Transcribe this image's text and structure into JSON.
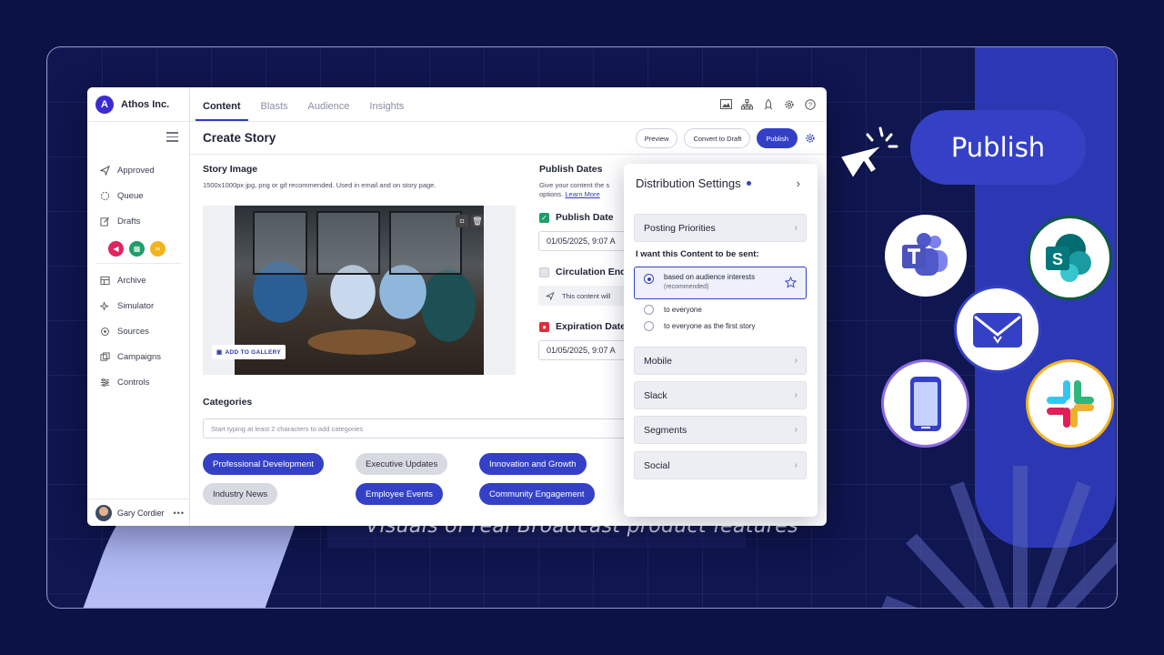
{
  "brand": {
    "name": "Athos Inc.",
    "logo_letter": "A"
  },
  "tabs": [
    {
      "label": "Content",
      "active": true
    },
    {
      "label": "Blasts",
      "active": false
    },
    {
      "label": "Audience",
      "active": false
    },
    {
      "label": "Insights",
      "active": false
    }
  ],
  "top_icons": [
    "image-icon",
    "sitemap-icon",
    "rocket-icon",
    "gear-icon",
    "help-icon"
  ],
  "page_title": "Create Story",
  "header_buttons": {
    "preview": "Preview",
    "convert": "Convert to Draft",
    "publish": "Publish"
  },
  "sidebar": {
    "items": [
      {
        "label": "Approved",
        "icon": "send-icon"
      },
      {
        "label": "Queue",
        "icon": "spinner-icon"
      },
      {
        "label": "Drafts",
        "icon": "edit-icon"
      },
      {
        "label": "Archive",
        "icon": "table-icon"
      },
      {
        "label": "Simulator",
        "icon": "sparkle-icon"
      },
      {
        "label": "Sources",
        "icon": "broadcast-icon"
      },
      {
        "label": "Campaigns",
        "icon": "stack-icon"
      },
      {
        "label": "Controls",
        "icon": "sliders-icon"
      }
    ],
    "chips": [
      {
        "icon": "megaphone-icon",
        "color": "#e0245e"
      },
      {
        "icon": "calendar-icon",
        "color": "#1e9e6a"
      },
      {
        "icon": "link-icon",
        "color": "#f2b41c"
      }
    ],
    "user": "Gary Cordier"
  },
  "story_image": {
    "label": "Story Image",
    "hint": "1500x1000px jpg, png or gif recommended. Used in email and on story page.",
    "gallery_button": "ADD TO GALLERY"
  },
  "categories": {
    "label": "Categories",
    "placeholder": "Start typing at least 2 characters to add categories",
    "tags": [
      {
        "label": "Professional Development",
        "style": "blue"
      },
      {
        "label": "Executive Updates",
        "style": "gray"
      },
      {
        "label": "Innovation and Growth",
        "style": "blue"
      },
      {
        "label": "Industry News",
        "style": "gray"
      },
      {
        "label": "Employee Events",
        "style": "blue"
      },
      {
        "label": "Community Engagement",
        "style": "blue"
      }
    ]
  },
  "publish_dates": {
    "label": "Publish Dates",
    "hint_line1": "Give your content the s",
    "hint_line2": "options.",
    "learn_more": "Learn More",
    "publish_date_label": "Publish Date",
    "publish_date_value": "01/05/2025, 9:07 A",
    "circulation_label": "Circulation End",
    "circulation_note": "This content will",
    "expiration_label": "Expiration Date",
    "expiration_value": "01/05/2025, 9:07 A"
  },
  "distribution": {
    "title": "Distribution Settings",
    "posting_priorities": "Posting Priorities",
    "want_label": "I want this Content to be sent:",
    "options": [
      {
        "label": "based on audience interests",
        "sub": "(recommended)",
        "selected": true
      },
      {
        "label": "to everyone",
        "selected": false
      },
      {
        "label": "to everyone as the first story",
        "selected": false
      }
    ],
    "sections": [
      "Mobile",
      "Slack",
      "Segments",
      "Social"
    ]
  },
  "publish_pill": "Publish",
  "channels": [
    "teams-icon",
    "sharepoint-icon",
    "email-icon",
    "mobile-icon",
    "slack-icon"
  ],
  "caption": "Visuals of real Broadcast product features"
}
